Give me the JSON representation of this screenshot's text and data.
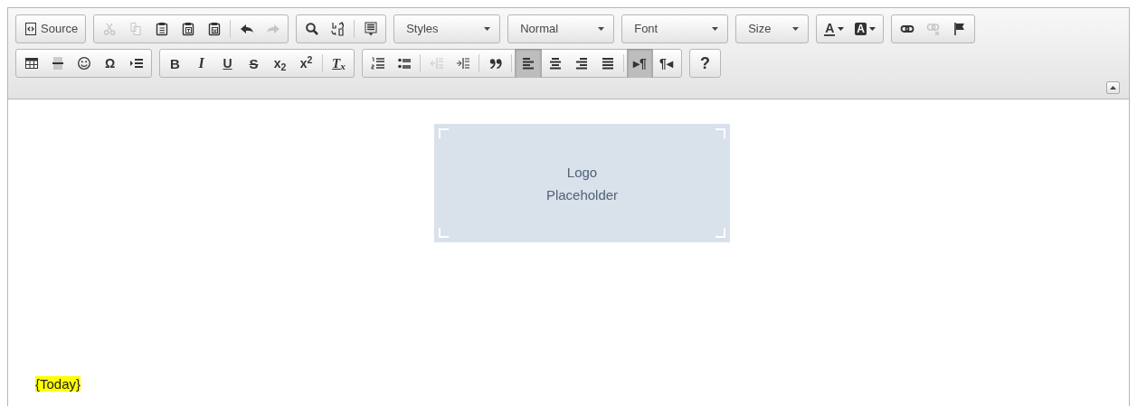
{
  "toolbar": {
    "rows": [
      [
        {
          "buttons": [
            {
              "kind": "source",
              "label": "Source",
              "disabled": false,
              "selected": false
            }
          ]
        },
        {
          "buttons": [
            {
              "kind": "cut",
              "disabled": true,
              "selected": false
            },
            {
              "kind": "copy",
              "disabled": true,
              "selected": false
            },
            {
              "kind": "paste",
              "disabled": false,
              "selected": false
            },
            {
              "kind": "paste-text",
              "disabled": false,
              "selected": false
            },
            {
              "kind": "paste-word",
              "disabled": false,
              "selected": false
            },
            {
              "kind": "separator"
            },
            {
              "kind": "undo",
              "disabled": false,
              "selected": false
            },
            {
              "kind": "redo",
              "disabled": true,
              "selected": false
            }
          ]
        },
        {
          "buttons": [
            {
              "kind": "find",
              "disabled": false,
              "selected": false
            },
            {
              "kind": "replace",
              "disabled": false,
              "selected": false
            },
            {
              "kind": "separator"
            },
            {
              "kind": "select-all",
              "disabled": false,
              "selected": false
            }
          ]
        },
        {
          "kind": "combo",
          "label": "Styles"
        },
        {
          "kind": "combo",
          "label": "Normal"
        },
        {
          "kind": "combo",
          "label": "Font"
        },
        {
          "kind": "combo",
          "label": "Size"
        },
        {
          "buttons": [
            {
              "kind": "text-color",
              "glyph": "A",
              "disabled": false,
              "selected": false
            },
            {
              "kind": "bg-color",
              "glyph": "A",
              "disabled": false,
              "selected": false
            }
          ]
        },
        {
          "buttons": [
            {
              "kind": "link",
              "disabled": false,
              "selected": false
            },
            {
              "kind": "unlink",
              "disabled": true,
              "selected": false
            },
            {
              "kind": "anchor",
              "disabled": false,
              "selected": false
            }
          ]
        }
      ],
      [
        {
          "buttons": [
            {
              "kind": "table",
              "disabled": false,
              "selected": false
            },
            {
              "kind": "hr",
              "disabled": false,
              "selected": false
            },
            {
              "kind": "smiley",
              "disabled": false,
              "selected": false
            },
            {
              "kind": "plain",
              "glyph": "Ω",
              "disabled": false,
              "selected": false
            },
            {
              "kind": "pagebreak",
              "disabled": false,
              "selected": false
            }
          ]
        },
        {
          "buttons": [
            {
              "kind": "bold",
              "glyph": "B",
              "disabled": false,
              "selected": false
            },
            {
              "kind": "italic",
              "glyph": "I",
              "disabled": false,
              "selected": false
            },
            {
              "kind": "underline",
              "glyph": "U",
              "disabled": false,
              "selected": false
            },
            {
              "kind": "strike",
              "glyph": "S",
              "disabled": false,
              "selected": false
            },
            {
              "kind": "script",
              "glyph": "x$_{2}$",
              "disabled": false,
              "selected": false
            },
            {
              "kind": "script",
              "glyph": "x$^{2}$",
              "disabled": false,
              "selected": false
            },
            {
              "kind": "separator"
            },
            {
              "kind": "remove-format",
              "glyph": "T$_{x}$",
              "disabled": false,
              "selected": false
            }
          ]
        },
        {
          "buttons": [
            {
              "kind": "ol",
              "disabled": false,
              "selected": false
            },
            {
              "kind": "ul",
              "disabled": false,
              "selected": false
            },
            {
              "kind": "separator"
            },
            {
              "kind": "outdent",
              "disabled": true,
              "selected": false
            },
            {
              "kind": "indent",
              "disabled": false,
              "selected": false
            },
            {
              "kind": "separator"
            },
            {
              "kind": "blockquote",
              "disabled": false,
              "selected": false
            },
            {
              "kind": "separator"
            },
            {
              "kind": "align-left",
              "disabled": false,
              "selected": true
            },
            {
              "kind": "align-center",
              "disabled": false,
              "selected": false
            },
            {
              "kind": "align-right",
              "disabled": false,
              "selected": false
            },
            {
              "kind": "justify",
              "disabled": false,
              "selected": false
            },
            {
              "kind": "separator"
            },
            {
              "kind": "plain",
              "glyph": "▸¶",
              "disabled": false,
              "selected": true
            },
            {
              "kind": "plain",
              "glyph": "¶◂",
              "disabled": false,
              "selected": false
            }
          ]
        },
        {
          "buttons": [
            {
              "kind": "help",
              "glyph": "?",
              "disabled": false,
              "selected": false
            }
          ]
        }
      ]
    ]
  },
  "document": {
    "logo_placeholder": {
      "lines": [
        "Logo",
        "Placeholder"
      ]
    },
    "paragraphs": [
      {
        "text": "{Today}",
        "highlighted": true
      }
    ]
  }
}
